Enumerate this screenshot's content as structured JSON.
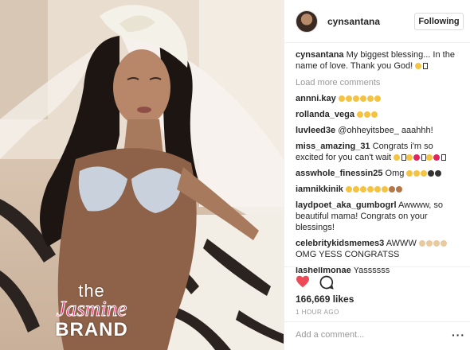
{
  "post": {
    "username": "cynsantana",
    "follow_label": "Following",
    "caption_user": "cynsantana",
    "caption_text": "My biggest blessing... In the name of love. Thank you God!",
    "load_more": "Load more comments",
    "likes": "166,669 likes",
    "time": "1 HOUR AGO",
    "comment_placeholder": "Add a comment...",
    "more_icon": "more-options-icon"
  },
  "comments": [
    {
      "user": "annni.kay",
      "text": ""
    },
    {
      "user": "rollanda_vega",
      "text": ""
    },
    {
      "user": "luvleed3e",
      "text": "@ohheyitsbee_ aaahhh!"
    },
    {
      "user": "miss_amazing_31",
      "text": "Congrats i'm so excited for you can't wait"
    },
    {
      "user": "asswhole_finessin25",
      "text": "Omg"
    },
    {
      "user": "iamnikkinik",
      "text": ""
    },
    {
      "user": "laydpoet_aka_gumbogrl",
      "text": "Awwww, so beautiful mama! Congrats on your blessings!"
    },
    {
      "user": "celebritykidsmemes3",
      "text": "AWWW"
    },
    {
      "user": "",
      "text": "OMG YESS CONGRATSS"
    },
    {
      "user": "lashellmonae",
      "text": "Yassssss"
    }
  ],
  "watermark": {
    "line1": "the",
    "line2": "Jasmine",
    "line3": "BRAND"
  },
  "colors": {
    "heart": "#ed4956",
    "watermark_pink": "#e2206f"
  }
}
